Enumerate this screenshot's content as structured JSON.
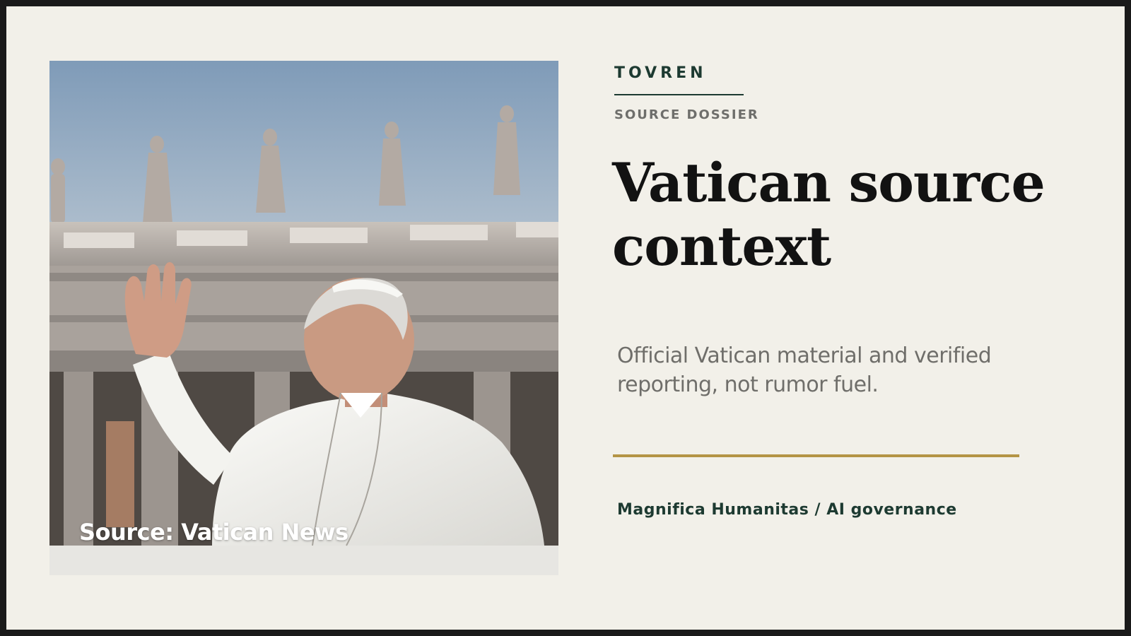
{
  "brand": {
    "name": "TOVREN"
  },
  "kicker": "SOURCE DOSSIER",
  "headline": "Vatican source context",
  "lede": "Official Vatican material and verified reporting, not rumor fuel.",
  "tagline": "Magnifica Humanitas / AI governance",
  "photo": {
    "caption": "Source: Vatican News"
  },
  "colors": {
    "background": "#f2f0e9",
    "brand_green": "#1d3a31",
    "gold_rule": "#b49445",
    "muted_text": "#6f6e6a",
    "headline_text": "#121212"
  }
}
